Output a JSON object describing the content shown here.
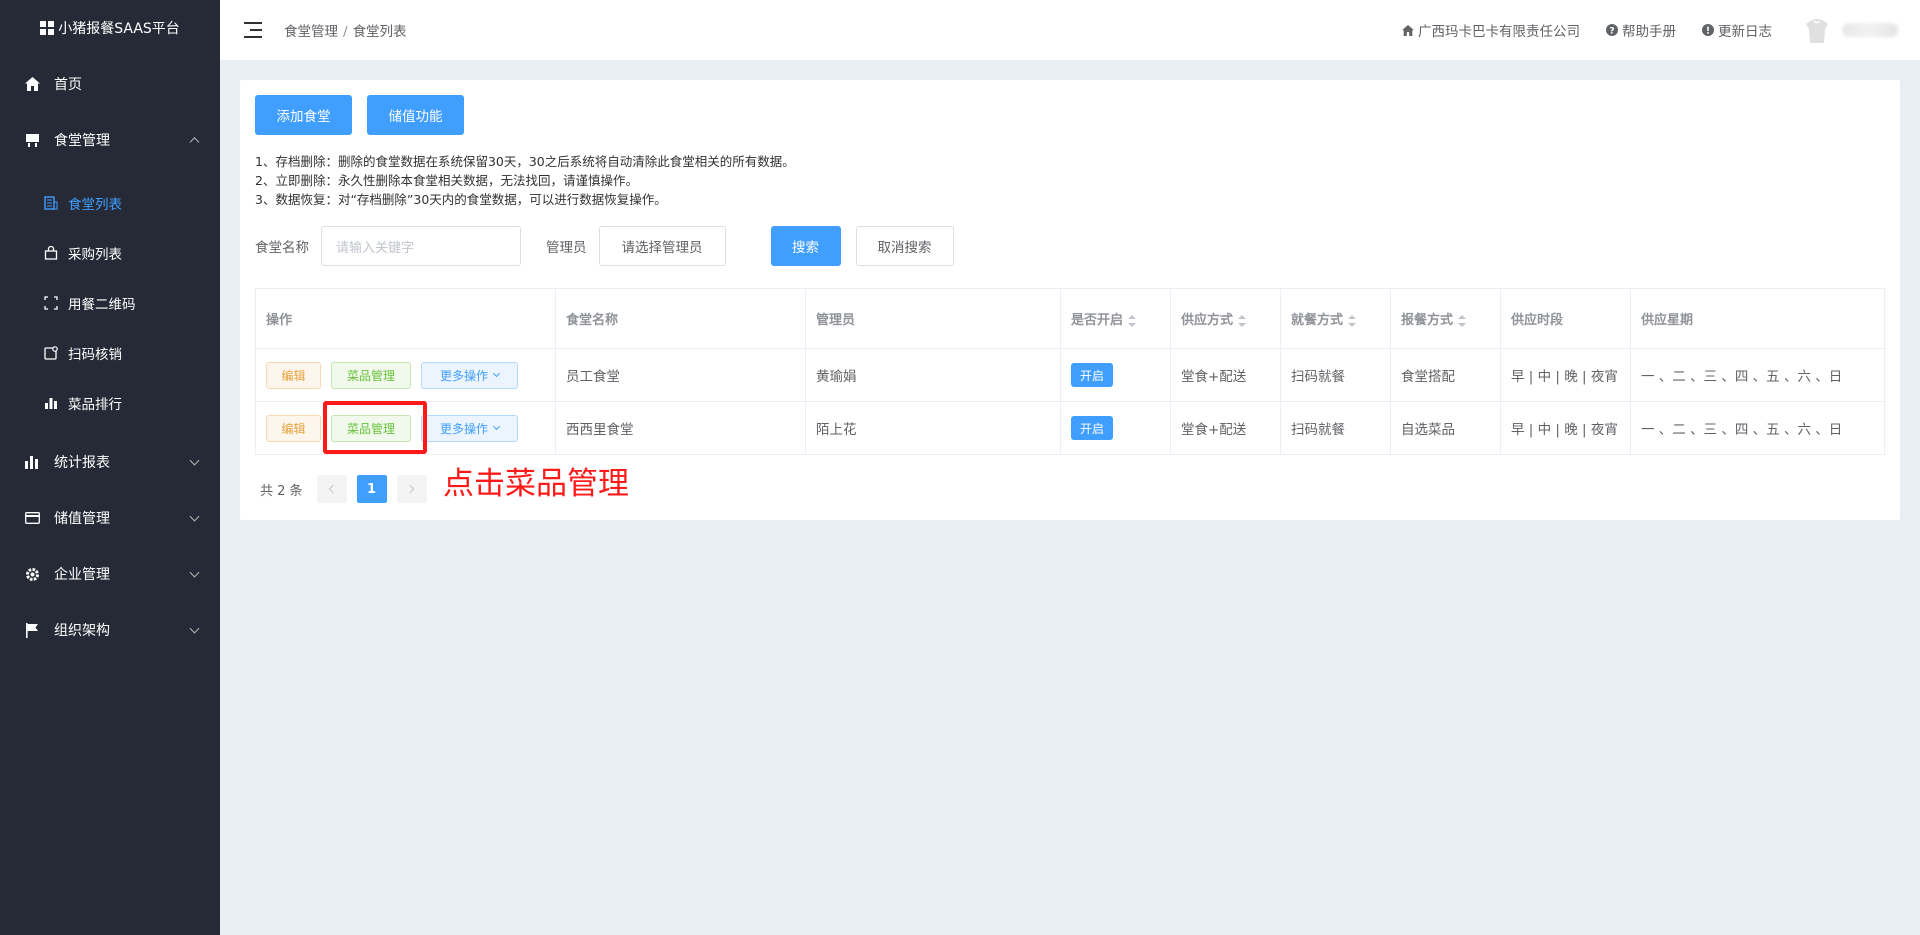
{
  "app": {
    "title": "小猪报餐SAAS平台"
  },
  "sidebar": {
    "items": [
      {
        "label": "首页",
        "icon": "home-icon"
      },
      {
        "label": "食堂管理",
        "icon": "canteen-icon",
        "expanded": true,
        "children": [
          {
            "label": "食堂列表",
            "icon": "list-icon",
            "active": true
          },
          {
            "label": "采购列表",
            "icon": "bag-icon"
          },
          {
            "label": "用餐二维码",
            "icon": "qrcode-icon"
          },
          {
            "label": "扫码核销",
            "icon": "scan-icon"
          },
          {
            "label": "菜品排行",
            "icon": "bar-chart-icon"
          }
        ]
      },
      {
        "label": "统计报表",
        "icon": "stats-icon"
      },
      {
        "label": "储值管理",
        "icon": "card-icon"
      },
      {
        "label": "企业管理",
        "icon": "gear-icon"
      },
      {
        "label": "组织架构",
        "icon": "flag-icon"
      }
    ]
  },
  "header": {
    "breadcrumb": [
      "食堂管理",
      "食堂列表"
    ],
    "breadcrumb_sep": "/",
    "company": "广西玛卡巴卡有限责任公司",
    "help": "帮助手册",
    "changelog": "更新日志"
  },
  "actions": {
    "add_canteen": "添加食堂",
    "stored_value": "储值功能"
  },
  "notes": [
    "1、存档删除：删除的食堂数据在系统保留30天，30之后系统将自动清除此食堂相关的所有数据。",
    "2、立即删除：永久性删除本食堂相关数据，无法找回，请谨慎操作。",
    "3、数据恢复：对“存档删除”30天内的食堂数据，可以进行数据恢复操作。"
  ],
  "filters": {
    "name_label": "食堂名称",
    "name_placeholder": "请输入关键字",
    "admin_label": "管理员",
    "admin_select": "请选择管理员",
    "search": "搜索",
    "cancel_search": "取消搜索"
  },
  "table": {
    "columns": [
      "操作",
      "食堂名称",
      "管理员",
      "是否开启",
      "供应方式",
      "就餐方式",
      "报餐方式",
      "供应时段",
      "供应星期"
    ],
    "row_buttons": {
      "edit": "编辑",
      "dish": "菜品管理",
      "more": "更多操作"
    },
    "rows": [
      {
        "name": "员工食堂",
        "admin": "黄瑜娟",
        "enabled": "开启",
        "supply": "堂食+配送",
        "dining": "扫码就餐",
        "order": "食堂搭配",
        "period": "早 | 中 | 晚 | 夜宵",
        "week": "一 、二 、三 、四 、五 、六 、日"
      },
      {
        "name": "西西里食堂",
        "admin": "陌上花",
        "enabled": "开启",
        "supply": "堂食+配送",
        "dining": "扫码就餐",
        "order": "自选菜品",
        "period": "早 | 中 | 晚 | 夜宵",
        "week": "一 、二 、三 、四 、五 、六 、日"
      }
    ]
  },
  "pagination": {
    "total": "共 2 条",
    "current": "1"
  },
  "annotation": {
    "text": "点击菜品管理",
    "color": "#ff1a1a"
  },
  "colors": {
    "primary": "#409eff",
    "sidebar_bg": "#252a36",
    "warning": "#e6a23c",
    "success": "#67c23a"
  }
}
